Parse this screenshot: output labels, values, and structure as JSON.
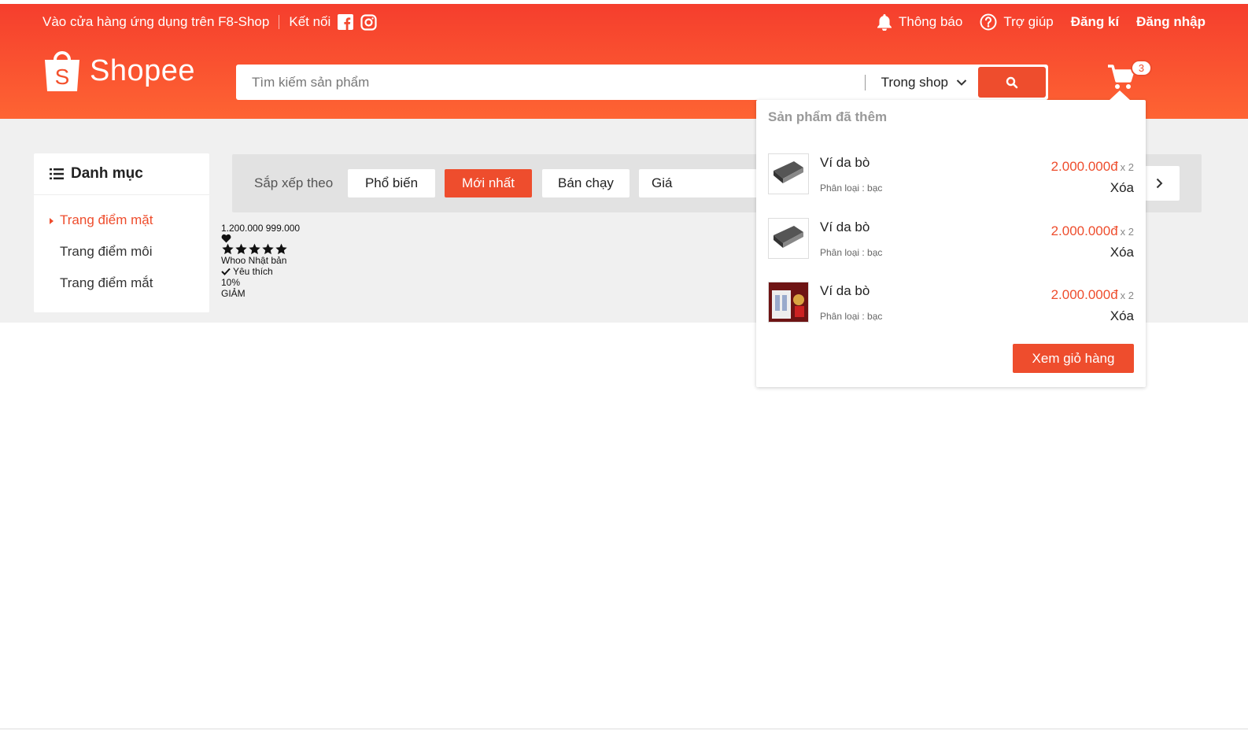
{
  "navbar": {
    "app_download": "Vào cửa hàng ứng dụng trên F8-Shop",
    "connect": "Kết nối",
    "notifications": "Thông báo",
    "help": "Trợ giúp",
    "register": "Đăng kí",
    "login": "Đăng nhập"
  },
  "logo": {
    "text": "Shopee"
  },
  "search": {
    "placeholder": "Tìm kiếm sản phẩm",
    "scope": "Trong shop"
  },
  "cart": {
    "count": "3",
    "dropdown_title": "Sản phẩm đã thêm",
    "items": [
      {
        "name": "Ví da bò",
        "variant": "Phân loại : bạc",
        "price": "2.000.000đ",
        "qty": "x 2",
        "remove": "Xóa"
      },
      {
        "name": "Ví da bò",
        "variant": "Phân loại : bạc",
        "price": "2.000.000đ",
        "qty": "x 2",
        "remove": "Xóa"
      },
      {
        "name": "Ví da bò",
        "variant": "Phân loại : bạc",
        "price": "2.000.000đ",
        "qty": "x 2",
        "remove": "Xóa"
      }
    ],
    "view_cart": "Xem giỏ hàng"
  },
  "sidebar": {
    "title": "Danh mục",
    "items": [
      {
        "label": "Trang điểm mặt"
      },
      {
        "label": "Trang điểm môi"
      },
      {
        "label": "Trang điểm mắt"
      }
    ]
  },
  "filter": {
    "label": "Sắp xếp theo",
    "popular": "Phổ biến",
    "newest": "Mới nhất",
    "best_selling": "Bán chạy",
    "price": "Giá"
  },
  "product": {
    "prices": "1.200.000 999.000",
    "origin": "Whoo Nhật bản",
    "favourite": "Yêu thích",
    "discount_percent": "10%",
    "discount_label": "GIẢM",
    "rating": 5
  },
  "colors": {
    "brand": "#ee4d2d",
    "header_top": "#f53e2d",
    "header_bottom": "#fe6433"
  }
}
